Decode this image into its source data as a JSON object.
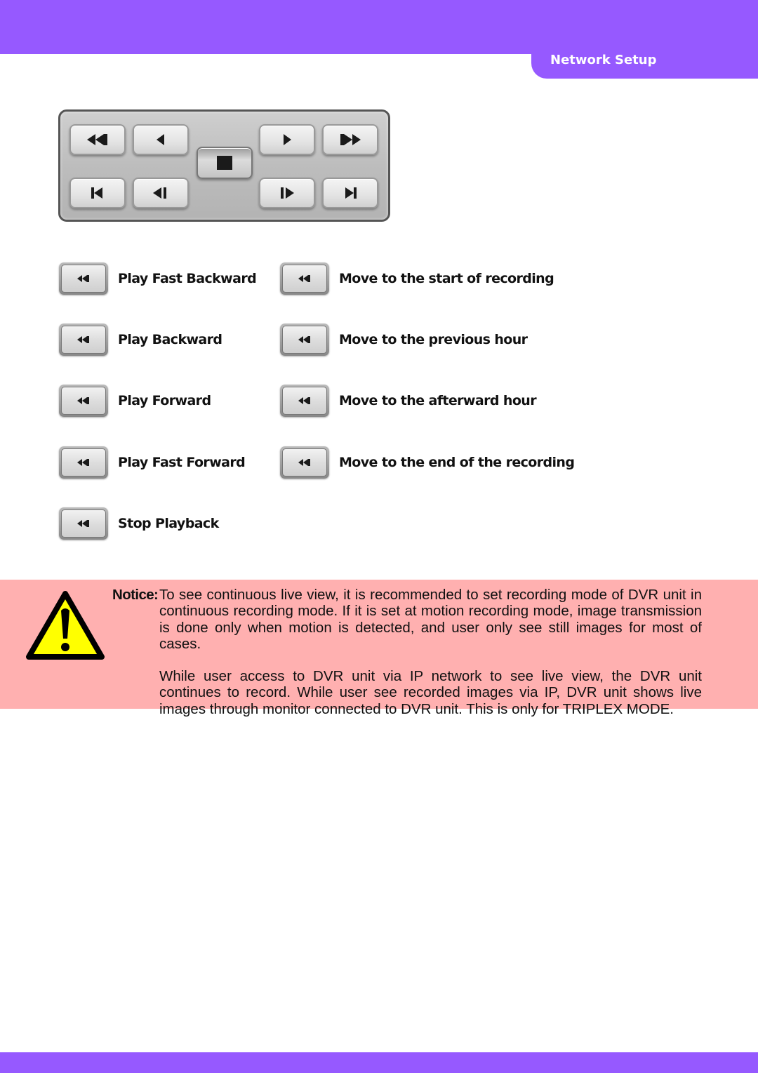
{
  "header": {
    "section_title": "Network Setup"
  },
  "theme": {
    "brand_purple": "#9659ff",
    "notice_bg": "#ffb0b0",
    "warning_yellow": "#ffff00"
  },
  "player_panel": {
    "top_row": [
      {
        "name": "fast-rewind",
        "icon": "fast-rewind-icon"
      },
      {
        "name": "play-backward",
        "icon": "play-backward-icon"
      },
      {
        "name": "play-forward",
        "icon": "play-forward-icon"
      },
      {
        "name": "fast-forward",
        "icon": "fast-forward-icon"
      }
    ],
    "center": {
      "name": "stop",
      "icon": "stop-icon"
    },
    "bottom_row": [
      {
        "name": "skip-to-start",
        "icon": "skip-to-start-icon"
      },
      {
        "name": "previous-hour",
        "icon": "step-backward-icon"
      },
      {
        "name": "next-hour",
        "icon": "step-forward-icon"
      },
      {
        "name": "skip-to-end",
        "icon": "skip-to-end-icon"
      }
    ]
  },
  "legend": {
    "left": [
      {
        "label": "Play Fast Backward",
        "icon": "fast-rewind-icon"
      },
      {
        "label": "Play Backward",
        "icon": "fast-rewind-icon"
      },
      {
        "label": "Play Forward",
        "icon": "fast-rewind-icon"
      },
      {
        "label": "Play Fast Forward",
        "icon": "fast-rewind-icon"
      },
      {
        "label": "Stop Playback",
        "icon": "fast-rewind-icon"
      }
    ],
    "right": [
      {
        "label": "Move to the start of recording",
        "icon": "fast-rewind-icon"
      },
      {
        "label": "Move to the previous hour",
        "icon": "fast-rewind-icon"
      },
      {
        "label": "Move to the afterward hour",
        "icon": "fast-rewind-icon"
      },
      {
        "label": "Move to the end of the recording",
        "icon": "fast-rewind-icon"
      }
    ]
  },
  "notice": {
    "label": "Notice:",
    "paragraph1": "To see continuous live view, it is recommended to set recording mode of DVR unit in continuous recording mode. If it is set at motion recording mode, image transmission is done only when motion is detected, and user only see still images for most of cases.",
    "paragraph2": "While user access to DVR unit via IP network to see live view, the DVR unit continues to record. While user see recorded images via IP, DVR unit shows live images through monitor connected to DVR unit. This is only for TRIPLEX MODE.",
    "icon": "warning-icon"
  }
}
